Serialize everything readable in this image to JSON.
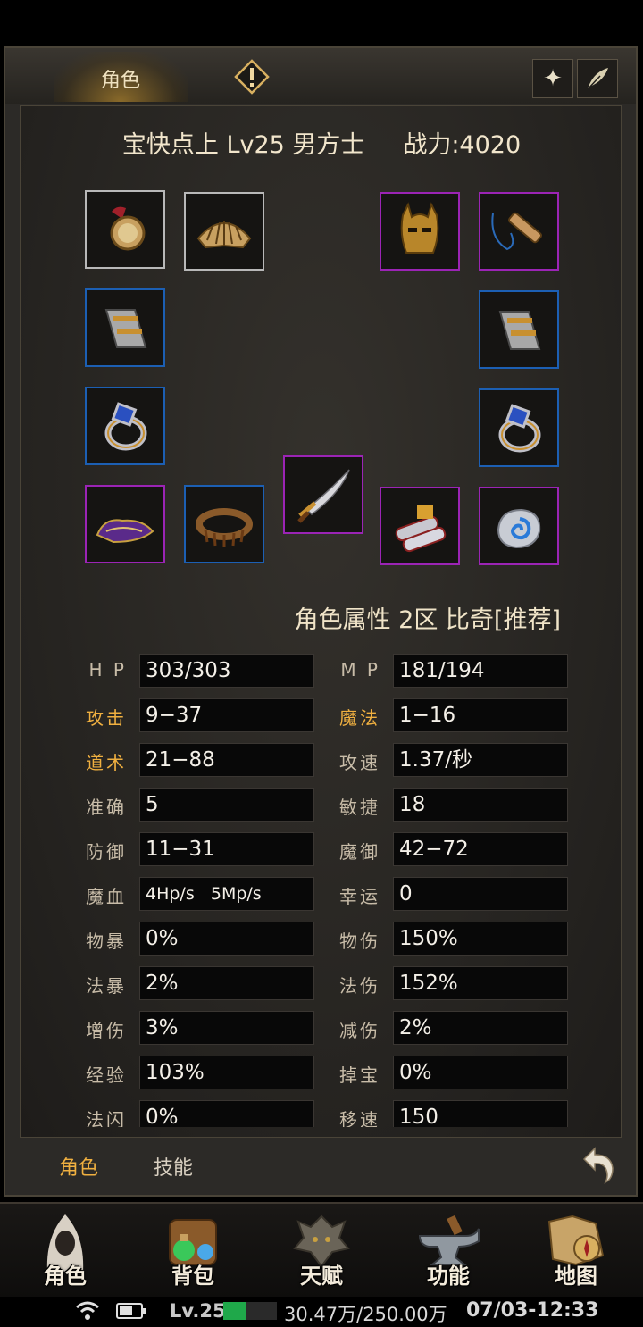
{
  "header": {
    "tab_role": "角色",
    "warn_icon": "exclamation-icon",
    "btn1_icon": "sparkle-icon",
    "btn2_icon": "feather-icon"
  },
  "character": {
    "title": "宝快点上 Lv25 男方士     战力:4020"
  },
  "equipment": [
    {
      "name": "medal",
      "rarity": "white"
    },
    {
      "name": "pauldron",
      "rarity": "white"
    },
    {
      "name": "helmet",
      "rarity": "purple"
    },
    {
      "name": "necklace",
      "rarity": "purple"
    },
    {
      "name": "bracer-left",
      "rarity": "blue"
    },
    {
      "name": "bracer-right",
      "rarity": "blue"
    },
    {
      "name": "ring-left",
      "rarity": "blue"
    },
    {
      "name": "ring-right",
      "rarity": "blue"
    },
    {
      "name": "boots",
      "rarity": "purple"
    },
    {
      "name": "belt",
      "rarity": "blue"
    },
    {
      "name": "weapon",
      "rarity": "purple"
    },
    {
      "name": "talisman",
      "rarity": "purple"
    },
    {
      "name": "gem",
      "rarity": "purple"
    }
  ],
  "attributes": {
    "title": "角色属性  2区 比奇[推荐]",
    "rows": [
      [
        {
          "label": "H P",
          "value": "303/303",
          "gold": false
        },
        {
          "label": "M P",
          "value": "181/194",
          "gold": false
        }
      ],
      [
        {
          "label": "攻击",
          "value": "9−37",
          "gold": true
        },
        {
          "label": "魔法",
          "value": "1−16",
          "gold": true
        }
      ],
      [
        {
          "label": "道术",
          "value": "21−88",
          "gold": true
        },
        {
          "label": "攻速",
          "value": "1.37/秒",
          "gold": false
        }
      ],
      [
        {
          "label": "准确",
          "value": "5",
          "gold": false
        },
        {
          "label": "敏捷",
          "value": "18",
          "gold": false
        }
      ],
      [
        {
          "label": "防御",
          "value": "11−31",
          "gold": false
        },
        {
          "label": "魔御",
          "value": "42−72",
          "gold": false
        }
      ],
      [
        {
          "label": "魔血",
          "value": "4Hp/s   5Mp/s",
          "gold": false
        },
        {
          "label": "幸运",
          "value": "0",
          "gold": false
        }
      ],
      [
        {
          "label": "物暴",
          "value": "0%",
          "gold": false
        },
        {
          "label": "物伤",
          "value": "150%",
          "gold": false
        }
      ],
      [
        {
          "label": "法暴",
          "value": "2%",
          "gold": false
        },
        {
          "label": "法伤",
          "value": "152%",
          "gold": false
        }
      ],
      [
        {
          "label": "增伤",
          "value": "3%",
          "gold": false
        },
        {
          "label": "减伤",
          "value": "2%",
          "gold": false
        }
      ],
      [
        {
          "label": "经验",
          "value": "103%",
          "gold": false
        },
        {
          "label": "掉宝",
          "value": "0%",
          "gold": false
        }
      ],
      [
        {
          "label": "法闪",
          "value": "0%",
          "gold": false
        },
        {
          "label": "移速",
          "value": "150",
          "gold": false
        }
      ]
    ]
  },
  "bottom_tabs": {
    "role": "角色",
    "skill": "技能",
    "back_icon": "back-arrow-icon"
  },
  "nav": [
    {
      "label": "角色",
      "icon": "hooded-figure-icon"
    },
    {
      "label": "背包",
      "icon": "backpack-potion-icon"
    },
    {
      "label": "天赋",
      "icon": "dragon-head-icon"
    },
    {
      "label": "功能",
      "icon": "anvil-icon"
    },
    {
      "label": "地图",
      "icon": "map-compass-icon"
    }
  ],
  "status": {
    "wifi_icon": "wifi-icon",
    "battery_icon": "battery-icon",
    "level": "Lv.25",
    "exp_progress": 0.12,
    "exp": "30.47万/250.00万",
    "time": "07/03-12:33"
  },
  "colors": {
    "gold_label": "#f0b040",
    "rarity_white": "#b8b8b8",
    "rarity_purple": "#9b24b5",
    "rarity_blue": "#1c5fb3",
    "exp_bar": "#1fa84a"
  }
}
